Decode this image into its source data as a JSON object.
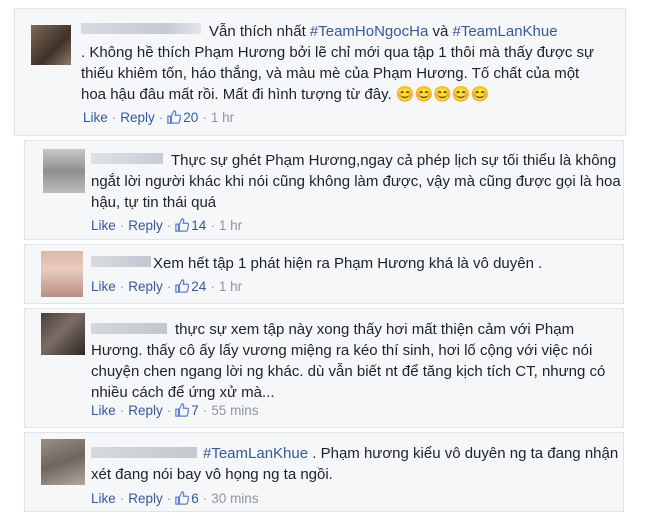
{
  "comments": [
    {
      "lead": "Vẫn thích nhất ",
      "tag1": "#TeamHoNgocHa",
      "mid": " và ",
      "tag2": "#TeamLanKhue",
      "body": ". Không hề thích Phạm Hương bởi lẽ chỉ mới qua tập 1 thôi mà thấy được sự thiếu khiêm tốn, háo thắng, và màu mè của Phạm Hương. Tố chất của một hoa hậu đâu mất rồi. Mất đi hình tượng từ đây.",
      "emoji": "😊😊😊😊😊",
      "like": "Like",
      "reply": "Reply",
      "count": "20",
      "time": "1 hr"
    },
    {
      "body": "Thực sự ghét Phạm Hương,ngay cả phép lịch sự tối thiểu là không ngắt lời người khác khi nói cũng không làm được, vậy mà cũng được gọi là hoa hậu, tự tin thái quá",
      "like": "Like",
      "reply": "Reply",
      "count": "14",
      "time": "1 hr"
    },
    {
      "body": "Xem hết tập 1 phát hiện ra Phạm Hương khá là vô duyên .",
      "like": "Like",
      "reply": "Reply",
      "count": "24",
      "time": "1 hr"
    },
    {
      "body": "thực sự xem tập này xong thấy hơi mất thiện cảm với Phạm Hương. thấy cô ấy lấy vương miệng ra kéo thí sinh, hơi lố cộng với việc nói chuyện chen ngang lời ng khác. dù vẫn biết nt để tăng kịch tích CT, nhưng có nhiều cách để ứng xử mà...",
      "like": "Like",
      "reply": "Reply",
      "count": "7",
      "time": "55 mins"
    },
    {
      "tag1": "#TeamLanKhue",
      "body": " . Phạm hương kiểu vô duyên ng ta đang nhận xét đang nói bay vô họng ng ta ngồi.",
      "like": "Like",
      "reply": "Reply",
      "count": "6",
      "time": "30 mins"
    }
  ],
  "colors": {
    "link": "#365899",
    "text": "#1d2129",
    "meta": "#90949c",
    "card": "#f6f7f9"
  }
}
